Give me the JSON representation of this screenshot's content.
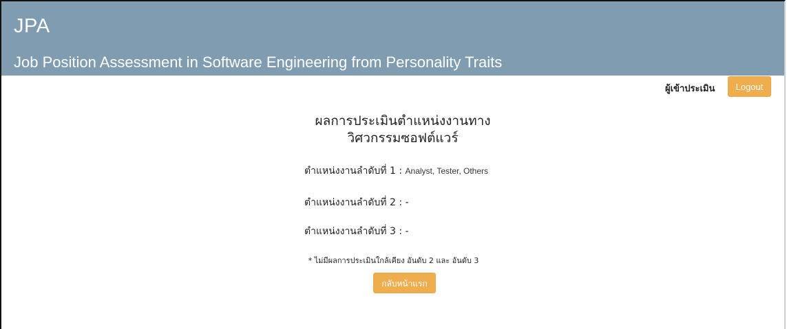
{
  "header": {
    "title": "JPA",
    "subtitle": "Job Position Assessment in Software Engineering from Personality Traits"
  },
  "user_bar": {
    "user_label": "ผู้เข้าประเมิน",
    "logout_label": "Logout"
  },
  "result": {
    "title_line1": "ผลการประเมินตำแหน่งงานทาง",
    "title_line2": "วิศวกรรมซอฟต์แวร์",
    "ranks": [
      {
        "label": "ตำแหน่งงานลำดับที่ 1 :",
        "value": "Analyst, Tester, Others"
      },
      {
        "label": "ตำแหน่งงานลำดับที่ 2 :",
        "value": "-"
      },
      {
        "label": "ตำแหน่งงานลำดับที่ 3 :",
        "value": "-"
      }
    ],
    "note": "* ไม่มีผลการประเมินใกล้เคียง อันดับ 2 และ อันดับ 3",
    "home_button_label": "กลับหน้าแรก"
  },
  "colors": {
    "header_bg": "#7f9cb0",
    "button_bg": "#f0ad4e"
  }
}
